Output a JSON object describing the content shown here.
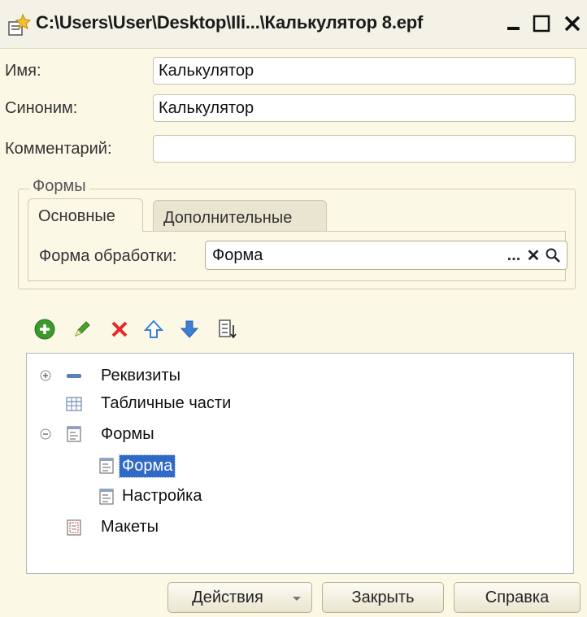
{
  "window": {
    "title": "C:\\Users\\User\\Desktop\\Ili...\\Калькулятор 8.epf"
  },
  "fields": {
    "name_label": "Имя:",
    "name_value": "Калькулятор",
    "synonym_label": "Синоним:",
    "synonym_value": "Калькулятор",
    "comment_label": "Комментарий:",
    "comment_value": ""
  },
  "forms_group": {
    "title": "Формы",
    "tabs": [
      {
        "label": "Основные",
        "active": true
      },
      {
        "label": "Дополнительные",
        "active": false
      }
    ],
    "form_label": "Форма обработки:",
    "form_value": "Форма",
    "select_glyph": "...",
    "clear_glyph": "✕"
  },
  "toolbar": {
    "items": [
      "add-icon",
      "edit-icon",
      "delete-icon",
      "move-up-icon",
      "move-down-icon",
      "sort-icon"
    ]
  },
  "tree": {
    "items": [
      {
        "label": "Реквизиты",
        "expander": "⊕",
        "icon": "attribute-icon"
      },
      {
        "label": "Табличные части",
        "icon": "table-icon"
      },
      {
        "label": "Формы",
        "expander": "⊖",
        "icon": "forms-icon"
      },
      {
        "label": "Форма",
        "icon": "form-icon",
        "selected": true
      },
      {
        "label": "Настройка",
        "icon": "form-icon"
      },
      {
        "label": "Макеты",
        "icon": "template-icon"
      }
    ]
  },
  "buttons": {
    "actions": "Действия",
    "close": "Закрыть",
    "help": "Справка"
  },
  "colors": {
    "background": "#fbf8e6",
    "selection": "#316ac5",
    "delete_red": "#e22b2b",
    "add_green": "#3a9a2a",
    "arrow_blue": "#3d7fd6"
  }
}
